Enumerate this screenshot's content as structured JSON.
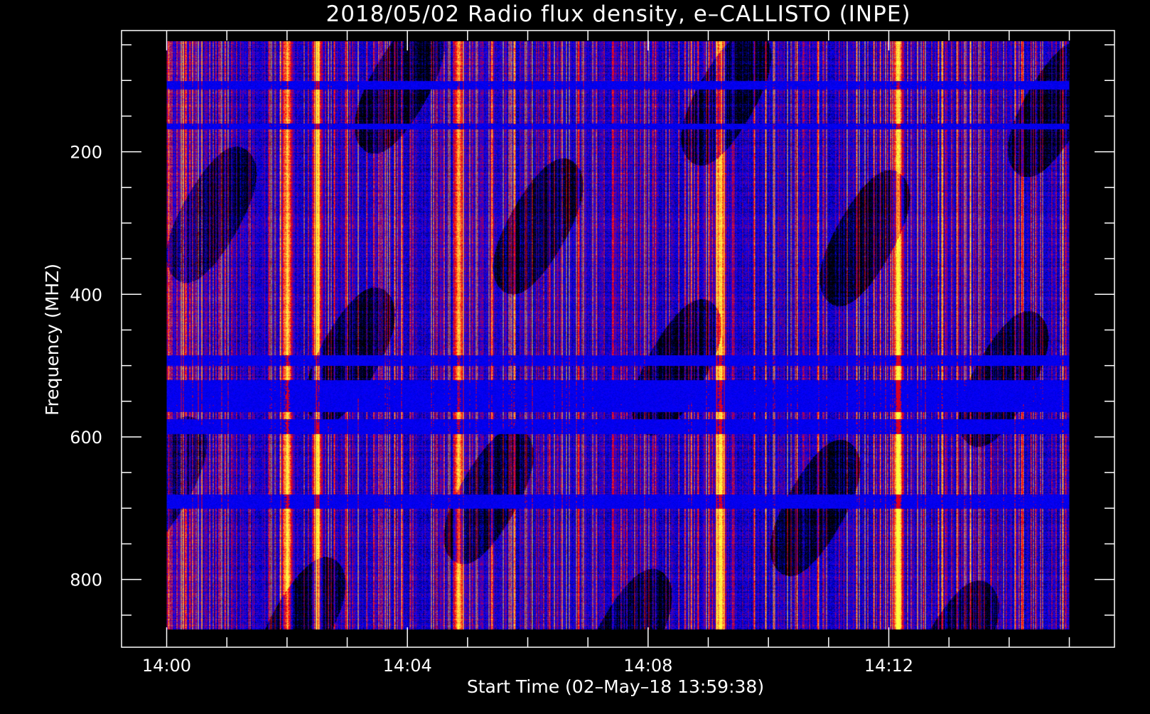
{
  "chart_data": {
    "type": "heatmap",
    "title": "2018/05/02  Radio flux density, e–CALLISTO (INPE)",
    "xlabel": "Start Time (02–May–18 13:59:38)",
    "ylabel": "Frequency (MHZ)",
    "x_tick_labels": [
      "14:00",
      "14:04",
      "14:08",
      "14:12"
    ],
    "x_tick_values_min": [
      0,
      4,
      8,
      12
    ],
    "x_range_min": [
      -0.75,
      15.75
    ],
    "x_data_range_min": [
      0,
      15
    ],
    "y_tick_labels": [
      "200",
      "400",
      "600",
      "800"
    ],
    "y_tick_values": [
      200,
      400,
      600,
      800
    ],
    "y_range": [
      30,
      895
    ],
    "y_data_range": [
      45,
      870
    ],
    "y_inverted": true,
    "colormap": [
      "#000000",
      "#0000ff",
      "#ff0000",
      "#ffa040",
      "#ffff40"
    ],
    "burst_columns": [
      {
        "time_min": 2.0,
        "intensity": 0.9
      },
      {
        "time_min": 2.5,
        "intensity": 0.5
      },
      {
        "time_min": 4.85,
        "intensity": 0.75
      },
      {
        "time_min": 9.2,
        "intensity": 0.8
      },
      {
        "time_min": 12.15,
        "intensity": 1.0
      }
    ],
    "interference_bands_mhz": [
      {
        "from": 100,
        "to": 112
      },
      {
        "from": 160,
        "to": 168
      },
      {
        "from": 485,
        "to": 500
      },
      {
        "from": 520,
        "to": 565
      },
      {
        "from": 575,
        "to": 595
      },
      {
        "from": 680,
        "to": 700
      }
    ]
  }
}
